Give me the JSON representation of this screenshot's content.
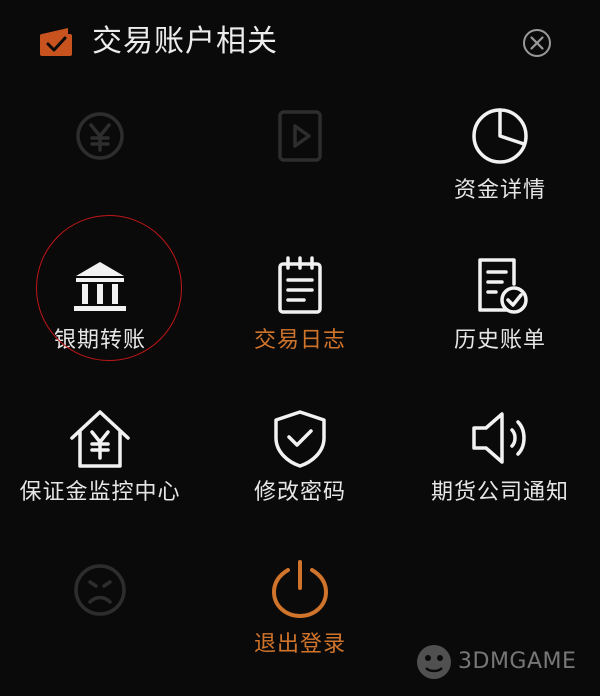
{
  "header": {
    "title": "交易账户相关",
    "icon": "wallet-icon",
    "close_icon": "close-icon"
  },
  "menu": [
    {
      "label": "",
      "icon": "yuan-circle-icon",
      "state": "disabled"
    },
    {
      "label": "",
      "icon": "play-document-icon",
      "state": "disabled"
    },
    {
      "label": "资金详情",
      "icon": "pie-chart-icon",
      "state": "normal"
    },
    {
      "label": "银期转账",
      "icon": "bank-icon",
      "state": "highlighted"
    },
    {
      "label": "交易日志",
      "icon": "notepad-icon",
      "state": "active"
    },
    {
      "label": "历史账单",
      "icon": "bill-check-icon",
      "state": "normal"
    },
    {
      "label": "保证金监控中心",
      "icon": "house-yuan-icon",
      "state": "normal"
    },
    {
      "label": "修改密码",
      "icon": "shield-check-icon",
      "state": "normal"
    },
    {
      "label": "期货公司通知",
      "icon": "speaker-icon",
      "state": "normal"
    },
    {
      "label": "",
      "icon": "sad-face-icon",
      "state": "disabled"
    },
    {
      "label": "退出登录",
      "icon": "power-icon",
      "state": "accent"
    }
  ],
  "colors": {
    "background": "#0a0a0a",
    "text": "#e6e6e6",
    "accent": "#d0742b",
    "highlight": "#c01616"
  },
  "watermark": {
    "text": "3DMGAME"
  }
}
